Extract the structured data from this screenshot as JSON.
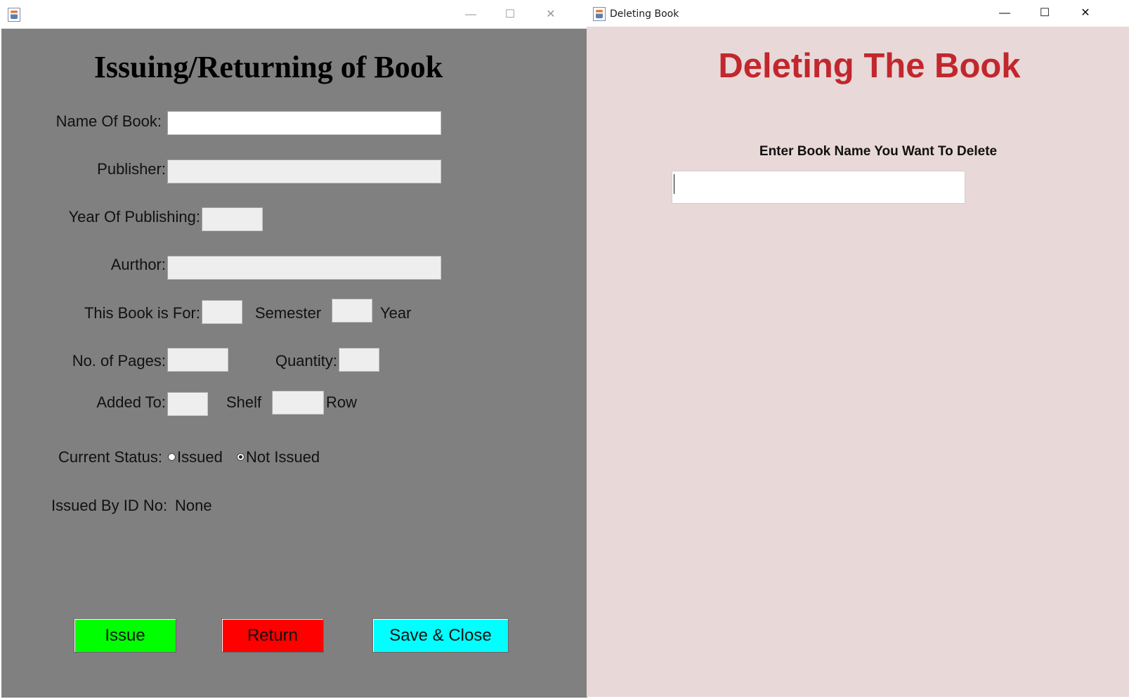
{
  "left_window": {
    "title": "",
    "heading": "Issuing/Returning of Book",
    "fields": {
      "name_of_book": {
        "label": "Name Of Book:",
        "value": ""
      },
      "publisher": {
        "label": "Publisher:",
        "value": ""
      },
      "year_of_publishing": {
        "label": "Year Of Publishing:",
        "value": ""
      },
      "author": {
        "label": "Aurthor:",
        "value": ""
      },
      "this_book_for": {
        "label": "This Book is For:",
        "value": ""
      },
      "semester": {
        "label": "Semester",
        "value": ""
      },
      "year": {
        "label": "Year"
      },
      "pages": {
        "label": "No. of Pages:",
        "value": ""
      },
      "quantity": {
        "label": "Quantity:",
        "value": ""
      },
      "added_to": {
        "label": "Added To:",
        "value": ""
      },
      "shelf": {
        "label": "Shelf",
        "value": ""
      },
      "row": {
        "label": "Row"
      }
    },
    "status": {
      "label": "Current Status:",
      "options": [
        "Issued",
        "Not Issued"
      ],
      "selected": "Not Issued"
    },
    "issued_by": {
      "label": "Issued By ID No:",
      "value": "None"
    },
    "buttons": {
      "issue": {
        "label": "Issue",
        "color": "#00ff00"
      },
      "return": {
        "label": "Return",
        "color": "#ff0000"
      },
      "save_close": {
        "label": "Save & Close",
        "color": "#00ffff"
      }
    },
    "controls": {
      "minimize_icon": "minimize-icon",
      "maximize_icon": "maximize-icon",
      "close_icon": "close-icon"
    }
  },
  "right_window": {
    "title": "Deleting Book",
    "heading": "Deleting The Book",
    "heading_color": "#c1272d",
    "prompt": "Enter Book Name You Want To Delete",
    "input_value": "",
    "background": "#e9d8d8"
  }
}
